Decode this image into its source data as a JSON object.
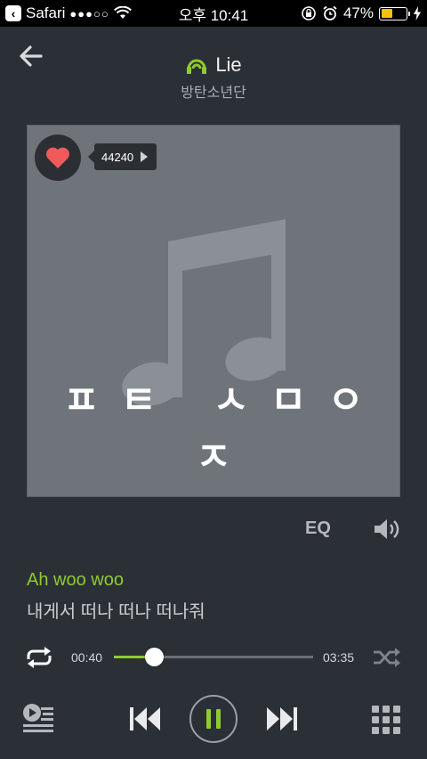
{
  "status_bar": {
    "app_back_label": "Safari",
    "signal": "●●●○○",
    "time": "오후 10:41",
    "battery_percent_label": "47%",
    "battery_level": 0.47
  },
  "header": {
    "title": "Lie",
    "artist": "방탄소년단"
  },
  "album": {
    "like_count": "44240",
    "caption": "ㅍㅌ ㅅㅁㅇㅈ"
  },
  "audio_controls": {
    "eq_label": "EQ"
  },
  "lyrics": {
    "current": "Ah woo woo",
    "next": "내게서 떠나 떠나 떠나줘"
  },
  "progress": {
    "current_time": "00:40",
    "total_time": "03:35",
    "fraction": 0.2
  },
  "colors": {
    "accent": "#8fcb2f",
    "heart": "#f05a5a",
    "background": "#2b3036"
  },
  "icons": [
    "back-arrow-icon",
    "signal-icon",
    "wifi-icon",
    "rotation-lock-icon",
    "alarm-icon",
    "battery-icon",
    "charging-icon",
    "listening-icon",
    "heart-icon",
    "music-note-icon",
    "volume-icon",
    "repeat-icon",
    "shuffle-icon",
    "playlist-icon",
    "previous-icon",
    "pause-icon",
    "next-icon",
    "grid-icon"
  ]
}
